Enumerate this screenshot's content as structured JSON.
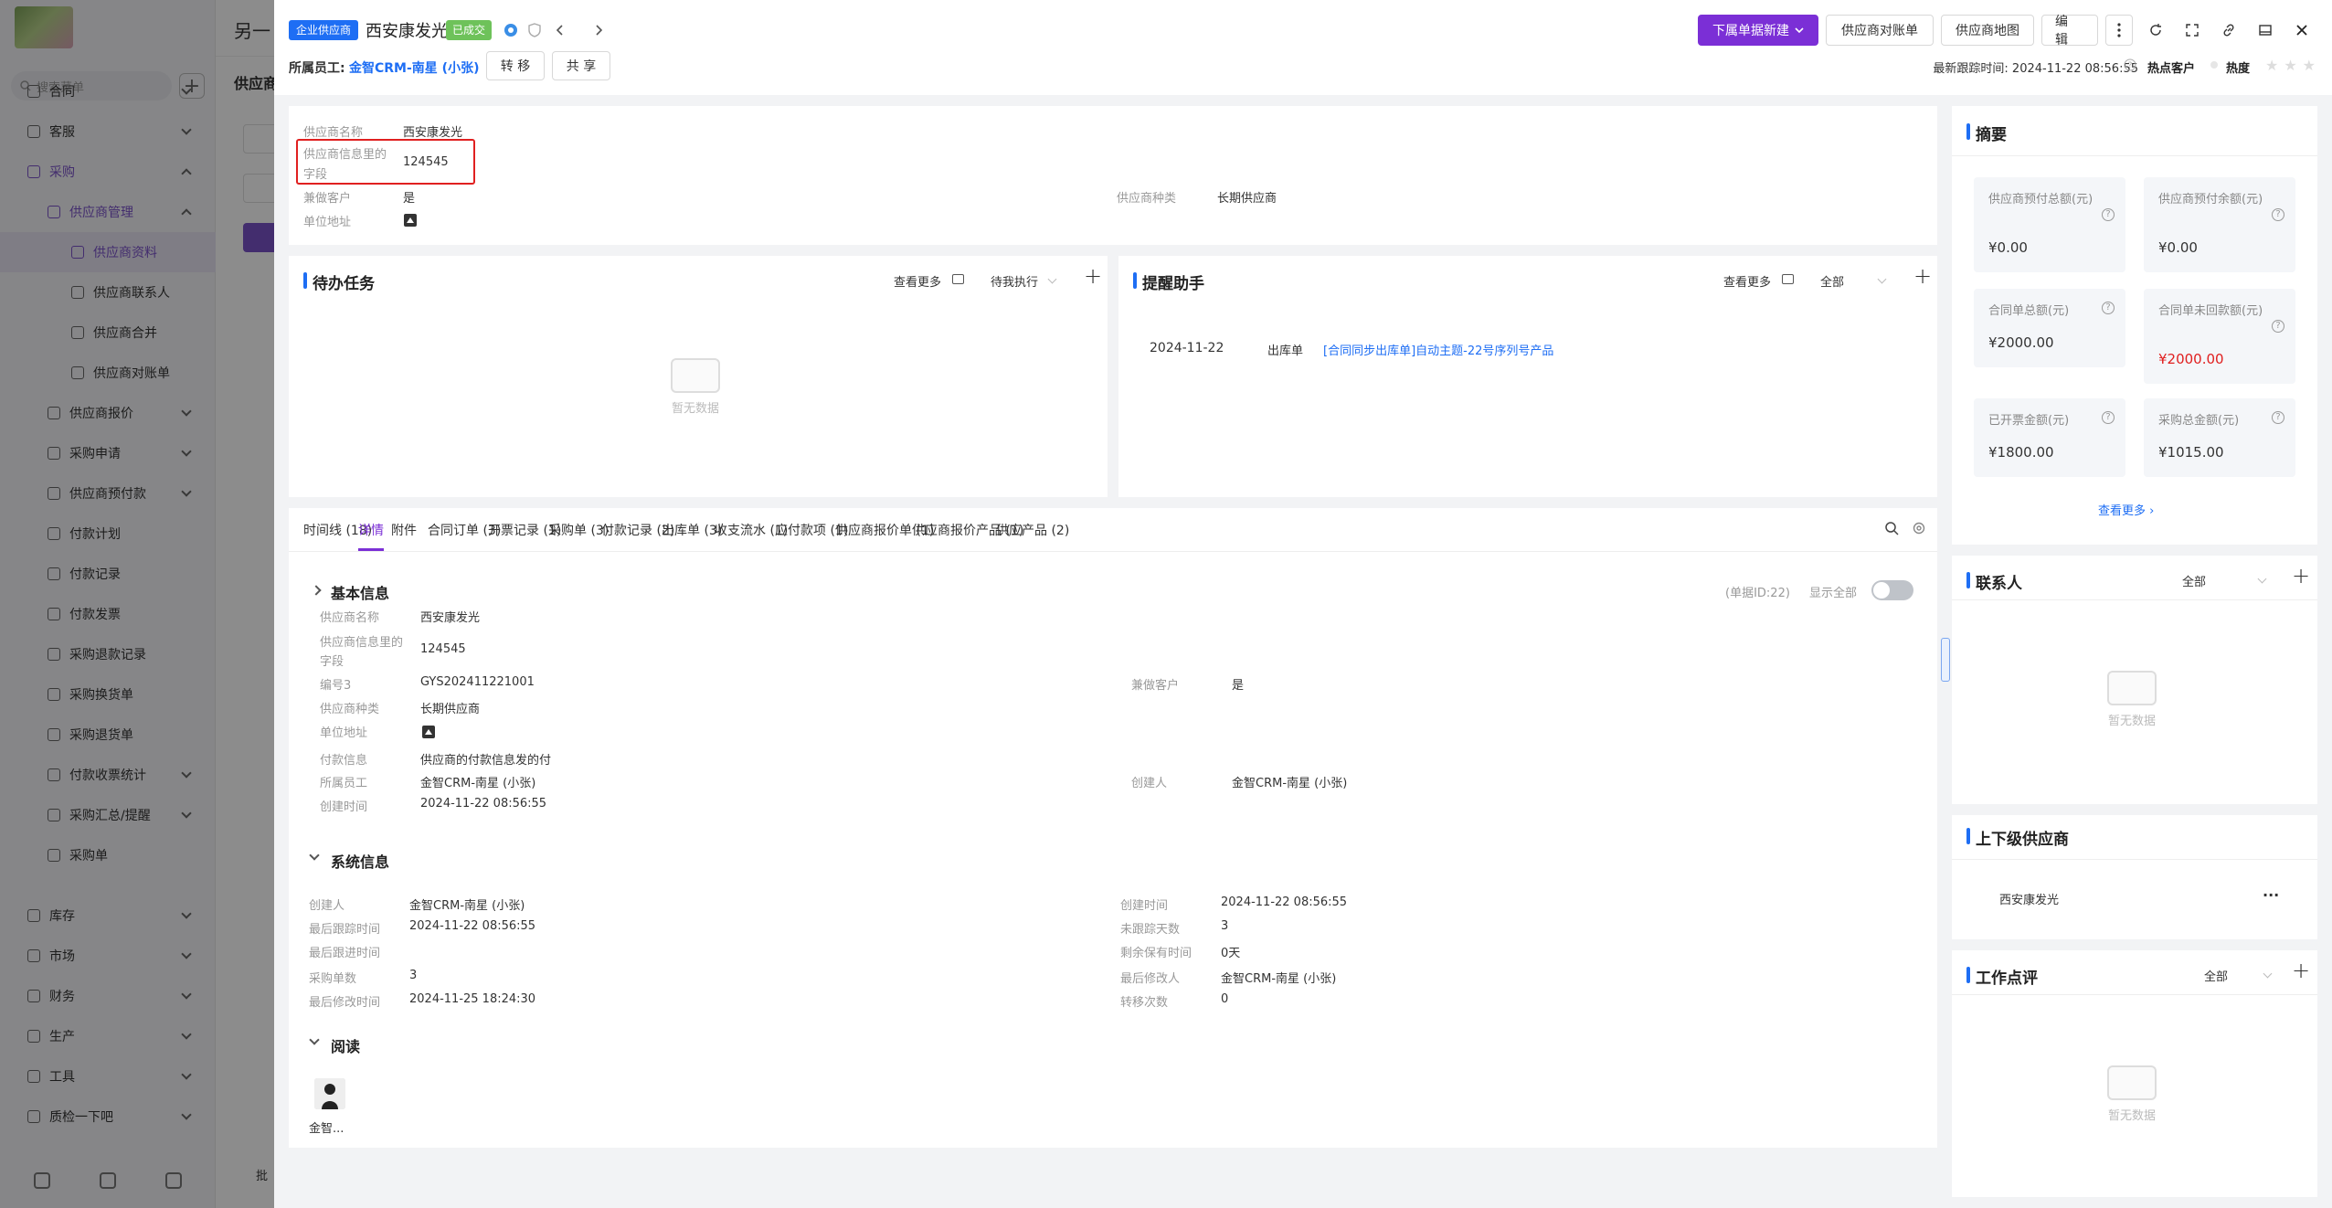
{
  "bg": {
    "title": "另一",
    "sub": "供应商",
    "search_placeholder": "搜索菜单",
    "menu": [
      {
        "label": "合同",
        "level": 1
      },
      {
        "label": "客服",
        "level": 1
      },
      {
        "label": "采购",
        "level": 1,
        "purple": true
      },
      {
        "label": "供应商管理",
        "level": 2,
        "purple": true
      },
      {
        "label": "供应商资料",
        "level": 3,
        "selected": true
      },
      {
        "label": "供应商联系人",
        "level": 3
      },
      {
        "label": "供应商合并",
        "level": 3
      },
      {
        "label": "供应商对账单",
        "level": 3
      },
      {
        "label": "供应商报价",
        "level": 2
      },
      {
        "label": "采购申请",
        "level": 2
      },
      {
        "label": "供应商预付款",
        "level": 2
      },
      {
        "label": "付款计划",
        "level": 2
      },
      {
        "label": "付款记录",
        "level": 2
      },
      {
        "label": "付款发票",
        "level": 2
      },
      {
        "label": "采购退款记录",
        "level": 2
      },
      {
        "label": "采购换货单",
        "level": 2
      },
      {
        "label": "采购退货单",
        "level": 2
      },
      {
        "label": "付款收票统计",
        "level": 2
      },
      {
        "label": "采购汇总/提醒",
        "level": 2
      },
      {
        "label": "采购单",
        "level": 2
      },
      {
        "label": "库存",
        "level": 1
      },
      {
        "label": "市场",
        "level": 1
      },
      {
        "label": "财务",
        "level": 1
      },
      {
        "label": "生产",
        "level": 1
      },
      {
        "label": "工具",
        "level": 1
      },
      {
        "label": "质检一下吧",
        "level": 1
      }
    ],
    "batch": "批"
  },
  "header": {
    "tag": "企业供应商",
    "name": "西安康发光",
    "status": "已成交",
    "owner_label": "所属员工:",
    "owner_value": "金智CRM-南星 (小张)",
    "transfer": "转 移",
    "share": "共 享",
    "new_btn": "下属单据新建",
    "statement_btn": "供应商对账单",
    "map_btn": "供应商地图",
    "edit_btn": "编 辑",
    "last_track": "最新跟踪时间: 2024-11-22 08:56:55",
    "hot_customer": "热点客户",
    "heat": "热度"
  },
  "top_fields": {
    "name_label": "供应商名称",
    "name_value": "西安康发光",
    "custom_label_1": "供应商信息里的",
    "custom_label_2": "字段",
    "custom_value": "124545",
    "also_customer_label": "兼做客户",
    "also_customer_value": "是",
    "kind_label": "供应商种类",
    "kind_value": "长期供应商",
    "address_label": "单位地址"
  },
  "todo": {
    "title": "待办任务",
    "more": "查看更多",
    "filter": "待我执行",
    "empty": "暂无数据"
  },
  "reminder": {
    "title": "提醒助手",
    "more": "查看更多",
    "filter": "全部",
    "row": {
      "date": "2024-11-22",
      "type": "出库单",
      "link": "[合同同步出库单]自动主题-22号序列号产品"
    }
  },
  "tabs": [
    {
      "label": "时间线 (18)"
    },
    {
      "label": "详情",
      "active": true
    },
    {
      "label": "附件"
    },
    {
      "label": "合同订单 (3)"
    },
    {
      "label": "开票记录 (1)"
    },
    {
      "label": "采购单 (3)"
    },
    {
      "label": "付款记录 (2)"
    },
    {
      "label": "出库单 (3)"
    },
    {
      "label": "收支流水 (1)"
    },
    {
      "label": "应付款项 (1)"
    },
    {
      "label": "供应商报价单 (1)"
    },
    {
      "label": "供应商报价产品 (1)"
    },
    {
      "label": "供应产品 (2)"
    }
  ],
  "basic": {
    "title": "基本信息",
    "doc_id": "(单据ID:22)",
    "show_all": "显示全部",
    "name_label": "供应商名称",
    "name_value": "西安康发光",
    "custom_label_1": "供应商信息里的",
    "custom_label_2": "字段",
    "custom_value": "124545",
    "code_label": "编号3",
    "code_value": "GYS202411221001",
    "also_customer_label": "兼做客户",
    "also_customer_value": "是",
    "kind_label": "供应商种类",
    "kind_value": "长期供应商",
    "address_label": "单位地址",
    "pay_label": "付款信息",
    "pay_value": "供应商的付款信息发的付",
    "owner_label": "所属员工",
    "owner_value": "金智CRM-南星 (小张)",
    "creator_label": "创建人",
    "creator_value": "金智CRM-南星 (小张)",
    "ctime_label": "创建时间",
    "ctime_value": "2024-11-22 08:56:55"
  },
  "system": {
    "title": "系统信息",
    "left": [
      {
        "label": "创建人",
        "value": "金智CRM-南星 (小张)"
      },
      {
        "label": "最后跟踪时间",
        "value": "2024-11-22 08:56:55"
      },
      {
        "label": "最后跟进时间",
        "value": ""
      },
      {
        "label": "采购单数",
        "value": "3"
      },
      {
        "label": "最后修改时间",
        "value": "2024-11-25 18:24:30"
      }
    ],
    "right": [
      {
        "label": "创建时间",
        "value": "2024-11-22 08:56:55"
      },
      {
        "label": "未跟踪天数",
        "value": "3"
      },
      {
        "label": "剩余保有时间",
        "value": "0天"
      },
      {
        "label": "最后修改人",
        "value": "金智CRM-南星 (小张)"
      },
      {
        "label": "转移次数",
        "value": "0"
      }
    ]
  },
  "read": {
    "title": "阅读",
    "name": "金智..."
  },
  "summary": {
    "title": "摘要",
    "items": [
      {
        "label": "供应商预付总额(元)",
        "value": "¥0.00"
      },
      {
        "label": "供应商预付余额(元)",
        "value": "¥0.00"
      },
      {
        "label": "合同单总额(元)",
        "value": "¥2000.00"
      },
      {
        "label": "合同单未回款额(元)",
        "value": "¥2000.00",
        "color": "#e02020"
      },
      {
        "label": "已开票金额(元)",
        "value": "¥1800.00"
      },
      {
        "label": "采购总金额(元)",
        "value": "¥1015.00"
      }
    ],
    "more": "查看更多"
  },
  "contacts": {
    "title": "联系人",
    "filter": "全部",
    "empty": "暂无数据"
  },
  "hierarchy": {
    "title": "上下级供应商",
    "item": "西安康发光",
    "more": "···"
  },
  "review": {
    "title": "工作点评",
    "filter": "全部",
    "empty": "暂无数据"
  },
  "colors": {
    "accent": "#7b2fd6",
    "blue": "#1e6ef4",
    "green": "#6ec25a",
    "red": "#e02020"
  }
}
